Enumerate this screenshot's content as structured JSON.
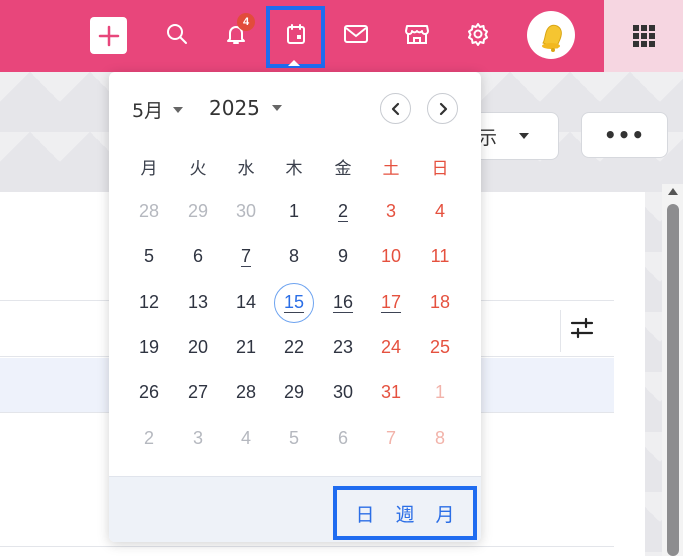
{
  "topbar": {
    "notification_count": "4",
    "icons": [
      "plus-icon",
      "search-icon",
      "bell-icon",
      "calendar-icon",
      "mail-icon",
      "store-icon",
      "gear-icon",
      "avatar",
      "apps-grid-icon"
    ]
  },
  "toolbar": {
    "display_label": "示",
    "more_label": "•••"
  },
  "calendar": {
    "month_label": "5月",
    "year_label": "2025",
    "weekdays": [
      "月",
      "火",
      "水",
      "木",
      "金",
      "土",
      "日"
    ],
    "weeks": [
      [
        "28",
        "29",
        "30",
        "1",
        "2",
        "3",
        "4"
      ],
      [
        "5",
        "6",
        "7",
        "8",
        "9",
        "10",
        "11"
      ],
      [
        "12",
        "13",
        "14",
        "15",
        "16",
        "17",
        "18"
      ],
      [
        "19",
        "20",
        "21",
        "22",
        "23",
        "24",
        "25"
      ],
      [
        "26",
        "27",
        "28",
        "29",
        "30",
        "31",
        "1"
      ],
      [
        "2",
        "3",
        "4",
        "5",
        "6",
        "7",
        "8"
      ]
    ],
    "today": "15",
    "views": {
      "day": "日",
      "week": "週",
      "month": "月"
    }
  },
  "colors": {
    "brand": "#e8467b",
    "weekend": "#e5513f",
    "accent": "#2b6ee6",
    "highlight_box": "#1f6cf0"
  }
}
